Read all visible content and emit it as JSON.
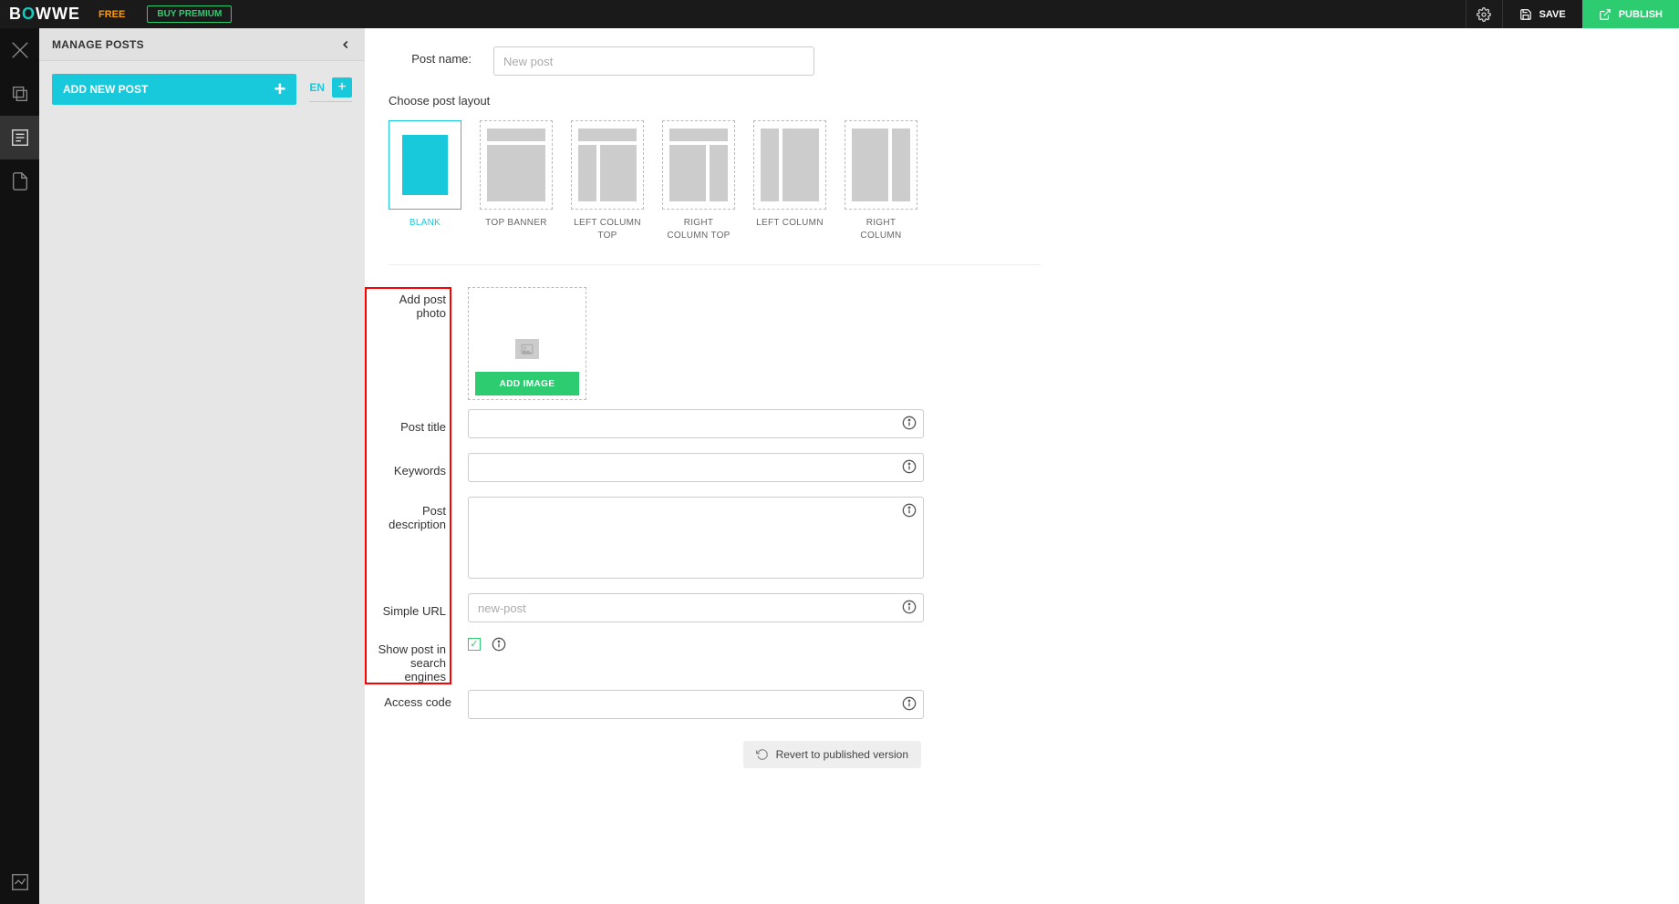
{
  "topbar": {
    "logo": "BOWWE",
    "plan": "FREE",
    "buy_premium": "BUY PREMIUM",
    "save": "SAVE",
    "publish": "PUBLISH"
  },
  "sidePanel": {
    "title": "MANAGE POSTS",
    "add_post": "ADD NEW POST",
    "lang": "EN"
  },
  "form": {
    "post_name_label": "Post name:",
    "post_name_placeholder": "New post",
    "choose_layout": "Choose post layout",
    "layouts": [
      {
        "label": "BLANK"
      },
      {
        "label": "TOP BANNER"
      },
      {
        "label": "LEFT COLUMN TOP"
      },
      {
        "label": "RIGHT COLUMN TOP"
      },
      {
        "label": "LEFT COLUMN"
      },
      {
        "label": "RIGHT COLUMN"
      }
    ],
    "add_photo_label": "Add post photo",
    "add_image_btn": "ADD IMAGE",
    "post_title_label": "Post title",
    "keywords_label": "Keywords",
    "post_description_label": "Post description",
    "simple_url_label": "Simple URL",
    "simple_url_placeholder": "new-post",
    "show_in_search_label": "Show post in search engines",
    "access_code_label": "Access code",
    "revert": "Revert to published version"
  }
}
